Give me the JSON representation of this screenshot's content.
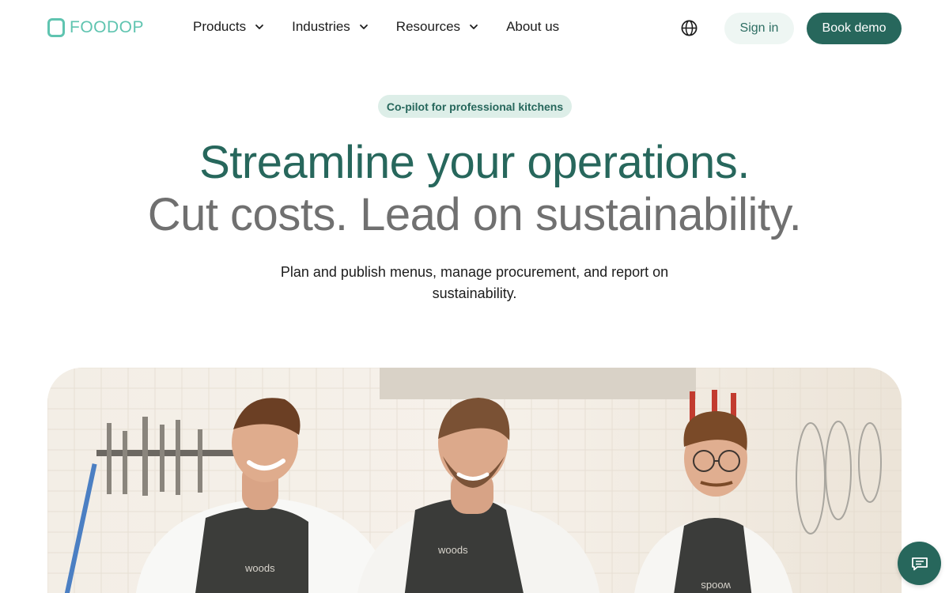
{
  "nav": {
    "logo_text": "FOODOP",
    "menu": [
      {
        "label": "Products",
        "has_dropdown": true
      },
      {
        "label": "Industries",
        "has_dropdown": true
      },
      {
        "label": "Resources",
        "has_dropdown": true
      },
      {
        "label": "About us",
        "has_dropdown": false
      }
    ],
    "globe_icon": "globe-icon",
    "sign_in_label": "Sign in",
    "book_demo_label": "Book demo"
  },
  "hero": {
    "badge": "Co-pilot for professional kitchens",
    "headline_line1": "Streamline your operations.",
    "headline_line2": "Cut costs. Lead on sustainability.",
    "subtext": "Plan and publish menus, manage procurement, and report on sustainability."
  },
  "hero_image": {
    "apron_labels": [
      "woods",
      "woods",
      "woods"
    ]
  },
  "chat": {
    "icon": "chat-icon"
  },
  "colors": {
    "brand_dark": "#27675c",
    "brand_light": "#5fc4b0",
    "badge_bg": "#ddeee8",
    "signin_bg": "#eef6f3",
    "headline_gray": "#707070"
  }
}
